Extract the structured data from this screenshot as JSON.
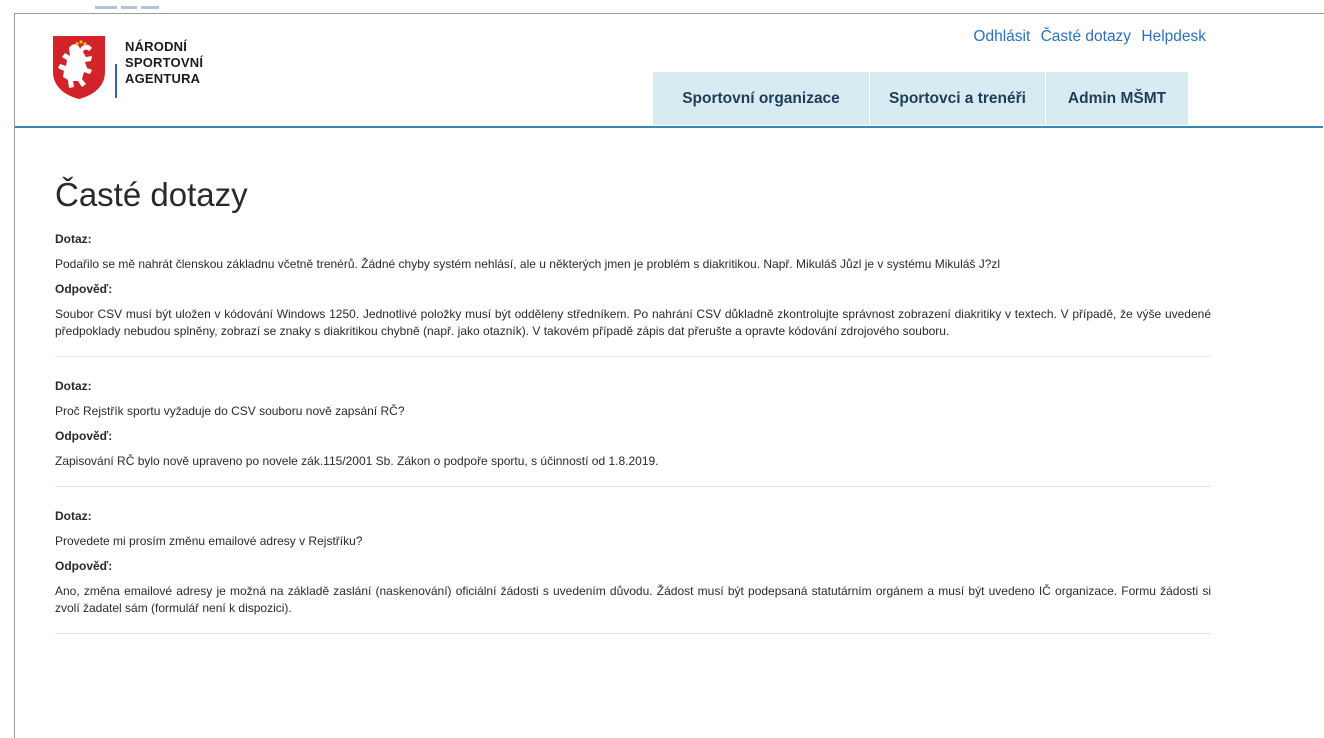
{
  "header": {
    "logo_lines": [
      "NÁRODNÍ",
      "SPORTOVNÍ",
      "AGENTURA"
    ],
    "utility_links": [
      "Odhlásit",
      "Časté dotazy",
      "Helpdesk"
    ],
    "nav_tabs": [
      "Sportovní organizace",
      "Sportovci a trenéři",
      "Admin MŠMT"
    ]
  },
  "colors": {
    "link": "#2b72b8",
    "nav_tab_bg": "#d7ebf3",
    "header_rule": "#3c87b0",
    "emblem_red": "#d2232a"
  },
  "page": {
    "title": "Časté dotazy"
  },
  "faq": {
    "question_label": "Dotaz:",
    "answer_label": "Odpověď:",
    "items": [
      {
        "question": "Podařilo se mě nahrát členskou základnu včetně trenérů. Žádné chyby systém nehlásí, ale u některých jmen je problém s diakritikou. Např. Mikuláš Jůzl je v systému Mikuláš J?zl",
        "answer": "Soubor CSV musí být uložen v kódování Windows 1250. Jednotlivé položky musí být odděleny středníkem. Po nahrání CSV důkladně zkontrolujte správnost zobrazení diakritiky v textech. V případě, že výše uvedené předpoklady nebudou splněny, zobrazí se znaky s diakritikou chybně (např. jako otazník). V takovém případě zápis dat přerušte a opravte kódování zdrojového souboru."
      },
      {
        "question": "Proč Rejstřík sportu vyžaduje do CSV souboru nově zapsání RČ?",
        "answer": "Zapisování RČ bylo nově upraveno po novele zák.115/2001 Sb. Zákon o podpoře sportu, s účinností od 1.8.2019."
      },
      {
        "question": "Provedete mi prosím změnu emailové adresy v Rejstříku?",
        "answer": "Ano, změna emailové adresy je možná na základě zaslání (naskenování) oficiální žádosti s uvedením důvodu. Žádost musí být podepsaná statutárním orgánem a musí být uvedeno IČ organizace. Formu žádosti si zvolí žadatel sám (formulář není k dispozici)."
      }
    ]
  }
}
